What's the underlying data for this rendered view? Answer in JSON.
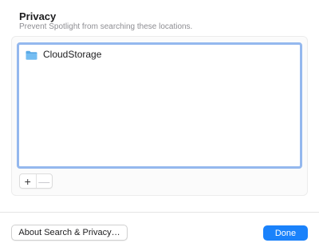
{
  "privacy": {
    "title": "Privacy",
    "subtitle": "Prevent Spotlight from searching these locations."
  },
  "locations": {
    "items": [
      {
        "label": "CloudStorage",
        "icon": "folder-icon"
      }
    ]
  },
  "controls": {
    "add_label": "+",
    "remove_label": "—"
  },
  "footer": {
    "about_label": "About Search & Privacy…",
    "done_label": "Done"
  },
  "colors": {
    "accent": "#1a82fb",
    "focus_ring": "#94b8ee",
    "folder": "#5aa9e6"
  }
}
